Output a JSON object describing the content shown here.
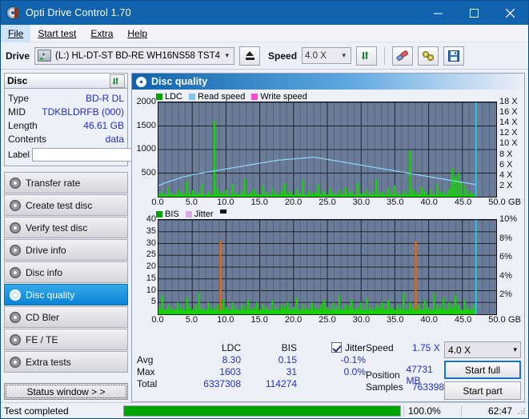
{
  "window": {
    "title": "Opti Drive Control 1.70",
    "icon": "disc-icon",
    "minimize": "–",
    "maximize": "□",
    "close": "✕"
  },
  "menu": [
    {
      "label": "File",
      "active": true
    },
    {
      "label": "Start test",
      "active": false
    },
    {
      "label": "Extra",
      "active": false
    },
    {
      "label": "Help",
      "active": false
    }
  ],
  "toolbar": {
    "drive_label": "Drive",
    "drive_value": "(L:)  HL-DT-ST BD-RE  WH16NS58 TST4",
    "eject_icon": "eject-icon",
    "speed_label": "Speed",
    "speed_value": "4.0 X",
    "refresh_icon": "refresh-icon",
    "erase_icon": "eraser-icon",
    "tools_icon": "tools-icon",
    "save_icon": "save-icon"
  },
  "disc": {
    "title": "Disc",
    "refresh_icon": "refresh-icon",
    "rows": [
      {
        "key": "Type",
        "value": "BD-R DL"
      },
      {
        "key": "MID",
        "value": "TDKBLDRFB (000)"
      },
      {
        "key": "Length",
        "value": "46.61 GB"
      },
      {
        "key": "Contents",
        "value": "data"
      }
    ],
    "label_key": "Label",
    "label_value": "",
    "label_placeholder": "",
    "disc_button_icon": "cd-icon"
  },
  "sidebar": {
    "items": [
      {
        "label": "Transfer rate",
        "active": false
      },
      {
        "label": "Create test disc",
        "active": false
      },
      {
        "label": "Verify test disc",
        "active": false
      },
      {
        "label": "Drive info",
        "active": false
      },
      {
        "label": "Disc info",
        "active": false
      },
      {
        "label": "Disc quality",
        "active": true
      },
      {
        "label": "CD Bler",
        "active": false
      },
      {
        "label": "FE / TE",
        "active": false
      },
      {
        "label": "Extra tests",
        "active": false
      }
    ],
    "status_window": "Status window > >"
  },
  "panel": {
    "title": "Disc quality",
    "icon": "disc-quality-icon"
  },
  "chart_data": [
    {
      "type": "bar",
      "name": "ldc-chart",
      "title": "",
      "xlabel": "GB",
      "ylabel": "",
      "ylim": [
        0,
        2000
      ],
      "yticks": [
        500,
        1000,
        1500,
        2000
      ],
      "xlim": [
        0,
        50
      ],
      "xticks": [
        "0.0",
        "5.0",
        "10.0",
        "15.0",
        "20.0",
        "25.0",
        "30.0",
        "35.0",
        "40.0",
        "45.0",
        "50.0"
      ],
      "xunit": "GB",
      "y2lim": [
        0,
        18
      ],
      "y2ticks": [
        "2 X",
        "4 X",
        "6 X",
        "8 X",
        "10 X",
        "12 X",
        "14 X",
        "16 X",
        "18 X"
      ],
      "grid": true,
      "legend": [
        {
          "label": "LDC",
          "color": "#00a400"
        },
        {
          "label": "Read speed",
          "color": "#7ec8f0"
        },
        {
          "label": "Write speed",
          "color": "#ff4ad8"
        }
      ],
      "series": [
        {
          "name": "LDC",
          "color": "#11d400",
          "kind": "bars",
          "values": [
            60,
            120,
            48,
            210,
            75,
            40,
            160,
            95,
            55,
            330,
            70,
            140,
            60,
            90,
            260,
            50,
            110,
            45,
            1603,
            180,
            90,
            70,
            150,
            40,
            260,
            85,
            60,
            120,
            380,
            55,
            95,
            160,
            70,
            45,
            230,
            100,
            60,
            180,
            90,
            50,
            120,
            280,
            70,
            110,
            40,
            160,
            90,
            360,
            55,
            130,
            70,
            95,
            250,
            60,
            110,
            45,
            180,
            90,
            60,
            140,
            55,
            200,
            75,
            110,
            40,
            290,
            65,
            95,
            150,
            60,
            120,
            380,
            70,
            100,
            45,
            180,
            60,
            240,
            85,
            55,
            130,
            70,
            980,
            160,
            90,
            60,
            200,
            110,
            45,
            150,
            70,
            260,
            95,
            120,
            55,
            180,
            600,
            420,
            520,
            310,
            240,
            140,
            90,
            60
          ]
        },
        {
          "name": "Read speed",
          "color": "#8fd8ff",
          "kind": "line",
          "values": [
            2.1,
            2.3,
            2.6,
            2.8,
            3.0,
            3.2,
            3.4,
            3.6,
            3.8,
            3.9,
            4.0,
            4.2,
            4.3,
            4.4,
            4.5,
            4.6,
            4.7,
            4.8,
            4.9,
            5.0,
            5.1,
            5.2,
            5.3,
            5.4,
            5.5,
            5.6,
            5.7,
            5.8,
            5.9,
            6.0,
            6.1,
            6.2,
            6.3,
            6.4,
            6.5,
            6.6,
            6.7,
            6.8,
            6.9,
            7.0,
            7.0,
            7.1,
            7.1,
            7.2,
            7.2,
            7.3,
            7.3,
            7.4,
            7.4,
            7.5,
            7.5,
            7.5,
            7.4,
            7.3,
            7.2,
            7.1,
            7.0,
            6.9,
            6.8,
            6.7,
            6.6,
            6.5,
            6.4,
            6.3,
            6.2,
            6.1,
            6.0,
            5.9,
            5.8,
            5.7,
            5.6,
            5.5,
            5.4,
            5.3,
            5.2,
            5.1,
            5.0,
            4.9,
            4.8,
            4.7,
            4.6,
            4.5,
            4.4,
            4.3,
            4.2,
            4.1,
            4.0,
            3.9,
            3.8,
            3.7,
            3.6,
            3.5,
            3.4,
            3.3,
            3.2,
            3.1,
            3.0,
            2.9,
            2.8,
            2.7,
            2.6,
            2.5,
            2.4,
            2.3
          ]
        }
      ],
      "end_marker_gb": 47.0,
      "end_marker_color": "#35c9f5"
    },
    {
      "type": "bar",
      "name": "bis-chart",
      "title": "",
      "xlabel": "GB",
      "ylabel": "",
      "ylim": [
        0,
        40
      ],
      "yticks": [
        5,
        10,
        15,
        20,
        25,
        30,
        35,
        40
      ],
      "xlim": [
        0,
        50
      ],
      "xticks": [
        "0.0",
        "5.0",
        "10.0",
        "15.0",
        "20.0",
        "25.0",
        "30.0",
        "35.0",
        "40.0",
        "45.0",
        "50.0"
      ],
      "xunit": "GB",
      "y2lim": [
        0,
        10
      ],
      "y2ticks": [
        "2%",
        "4%",
        "6%",
        "8%",
        "10%"
      ],
      "grid": true,
      "legend": [
        {
          "label": "BIS",
          "color": "#00a400"
        },
        {
          "label": "Jitter",
          "color": "#d8a8e0"
        }
      ],
      "series": [
        {
          "name": "BIS",
          "color": "#11d400",
          "kind": "bars",
          "values": [
            3,
            8,
            2,
            4,
            3,
            2,
            5,
            3,
            2,
            7,
            3,
            2,
            4,
            9,
            3,
            2,
            5,
            3,
            2,
            4,
            31,
            6,
            3,
            2,
            5,
            3,
            2,
            4,
            3,
            6,
            2,
            3,
            5,
            2,
            4,
            3,
            2,
            6,
            3,
            2,
            4,
            3,
            5,
            2,
            3,
            7,
            2,
            4,
            3,
            2,
            5,
            3,
            2,
            4,
            6,
            3,
            2,
            5,
            3,
            8,
            2,
            4,
            3,
            6,
            2,
            3,
            5,
            2,
            7,
            3,
            2,
            4,
            3,
            5,
            2,
            6,
            3,
            2,
            4,
            3,
            9,
            2,
            5,
            3,
            31,
            4,
            2,
            6,
            3,
            2,
            9,
            4,
            3,
            7,
            2,
            5,
            3,
            8,
            4,
            2,
            6,
            3,
            2,
            4
          ]
        }
      ],
      "end_marker_gb": 47.0,
      "end_marker_color": "#35c9f5"
    }
  ],
  "stats": {
    "headers": {
      "ldc": "LDC",
      "bis": "BIS",
      "jitter": "Jitter"
    },
    "jitter_checked": true,
    "rows": [
      {
        "label": "Avg",
        "ldc": "8.30",
        "bis": "0.15",
        "jitter": "-0.1%"
      },
      {
        "label": "Max",
        "ldc": "1603",
        "bis": "31",
        "jitter": "0.0%"
      },
      {
        "label": "Total",
        "ldc": "6337308",
        "bis": "114274",
        "jitter": ""
      }
    ],
    "speed_label": "Speed",
    "speed_value": "1.75 X",
    "position_label": "Position",
    "position_value": "47731 MB",
    "samples_label": "Samples",
    "samples_value": "763398",
    "speed_select": "4.0 X",
    "start_full": "Start full",
    "start_part": "Start part"
  },
  "statusbar": {
    "text": "Test completed",
    "progress_pct": "100.0%",
    "progress_value": 100,
    "time": "62:47"
  },
  "colors": {
    "title_bar": "#1263ad",
    "accent": "#0a84d8",
    "plot_bg": "#6b7c99",
    "bar_green": "#11d400",
    "read_speed": "#8fd8ff",
    "progress_green": "#00a400",
    "value_text": "#2030c0"
  }
}
